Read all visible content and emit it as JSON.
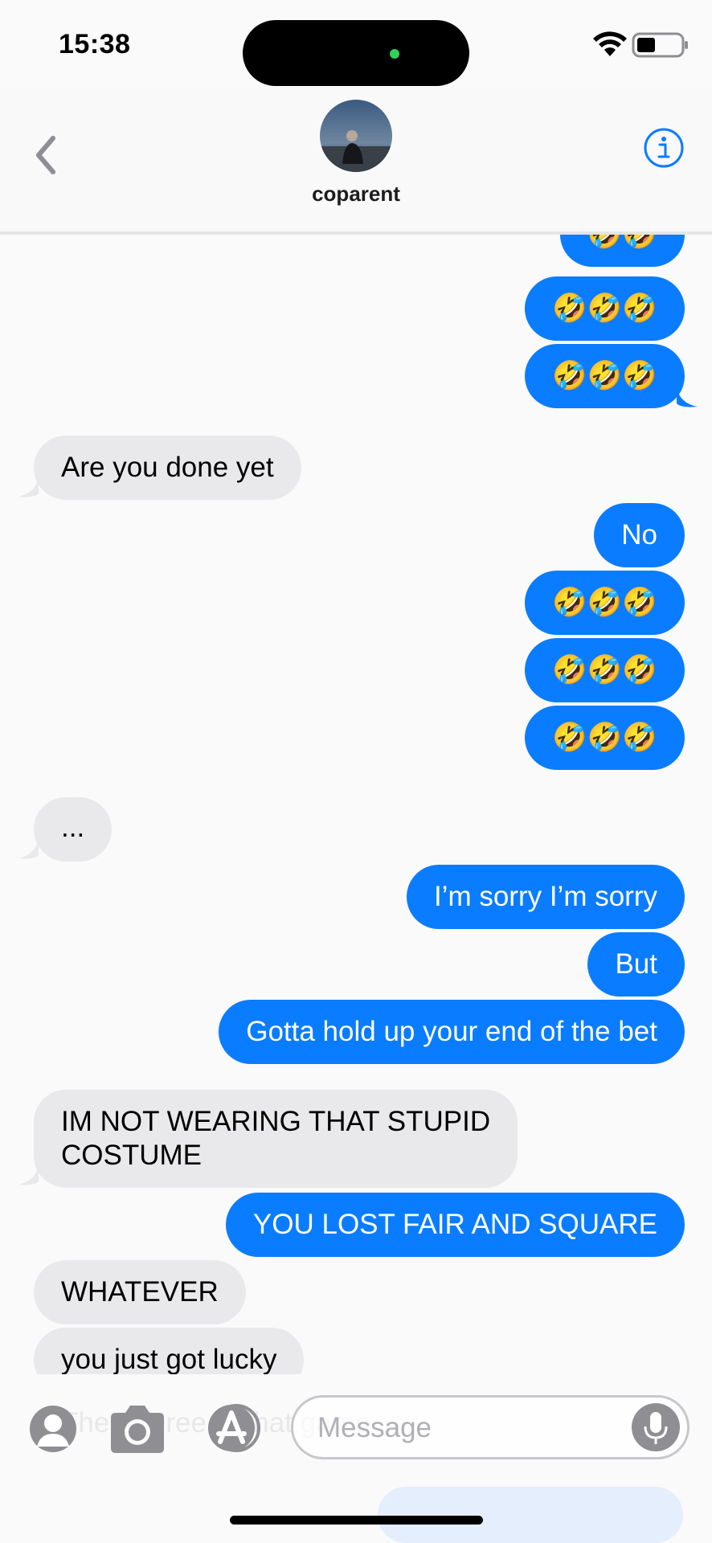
{
  "status_bar": {
    "time": "15:38"
  },
  "header": {
    "contact_name": "coparent"
  },
  "thread": {
    "messages": [
      {
        "dir": "out",
        "text": "🤣🤣"
      },
      {
        "dir": "out",
        "text": "🤣🤣🤣"
      },
      {
        "dir": "out",
        "text": "🤣🤣🤣"
      },
      {
        "dir": "in",
        "text": "Are you done yet"
      },
      {
        "dir": "out",
        "text": "No"
      },
      {
        "dir": "out",
        "text": "🤣🤣🤣"
      },
      {
        "dir": "out",
        "text": "🤣🤣🤣"
      },
      {
        "dir": "out",
        "text": "🤣🤣🤣"
      },
      {
        "dir": "in",
        "text": "..."
      },
      {
        "dir": "out",
        "text": "I’m sorry I’m sorry"
      },
      {
        "dir": "out",
        "text": "But"
      },
      {
        "dir": "out",
        "text": "Gotta hold up your end of the bet"
      },
      {
        "dir": "in",
        "text": "IM NOT WEARING THAT STUPID"
      },
      {
        "dir": "in",
        "text": "COSTUME"
      },
      {
        "dir": "out",
        "text": "YOU LOST FAIR AND SQUARE"
      },
      {
        "dir": "in",
        "text": "WHATEVER"
      },
      {
        "dir": "in",
        "text": "you just got lucky"
      }
    ]
  },
  "compose": {
    "placeholder": "Message",
    "behind_text": "The referee ... that game"
  },
  "colors": {
    "outgoing": "#0a7cff",
    "incoming": "#e9e9eb",
    "accent": "#0a7cff"
  }
}
